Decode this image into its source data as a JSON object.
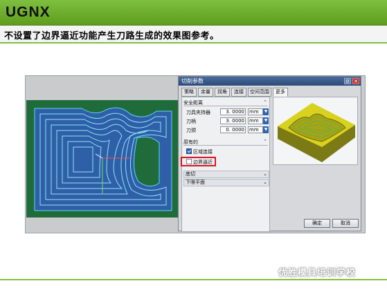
{
  "slide": {
    "title": "UGNX",
    "caption": "不设置了边界逼近功能产生刀路生成的效果图参考。"
  },
  "dialog": {
    "title": "切削参数",
    "tabs": [
      "策略",
      "余量",
      "拐角",
      "连接",
      "空间范围",
      "更多"
    ],
    "active_tab": "更多",
    "safe_clearance": {
      "header": "安全距离",
      "rows": [
        {
          "label": "刀具夹持器",
          "value": "3. 0000",
          "unit": "mm"
        },
        {
          "label": "刀柄",
          "value": "3. 0000",
          "unit": "mm"
        },
        {
          "label": "刀颈",
          "value": "0. 0000",
          "unit": "mm"
        }
      ]
    },
    "original": {
      "header": "原有的",
      "region_connect": {
        "label": "区域连接",
        "checked": true
      },
      "boundary_approach": {
        "label": "边界逼近",
        "checked": false
      }
    },
    "collapsed_sections": [
      "底切",
      "下限平面"
    ],
    "ok_label": "确定",
    "cancel_label": "取消"
  },
  "watermark": "优胜模具培训学校",
  "colors": {
    "header_green": "#6fae2e",
    "viewport_blue": "#2a4f8a",
    "part_green": "#1f6b3a",
    "toolpath": "#4fd2ff",
    "highlight_red": "#e01020"
  }
}
